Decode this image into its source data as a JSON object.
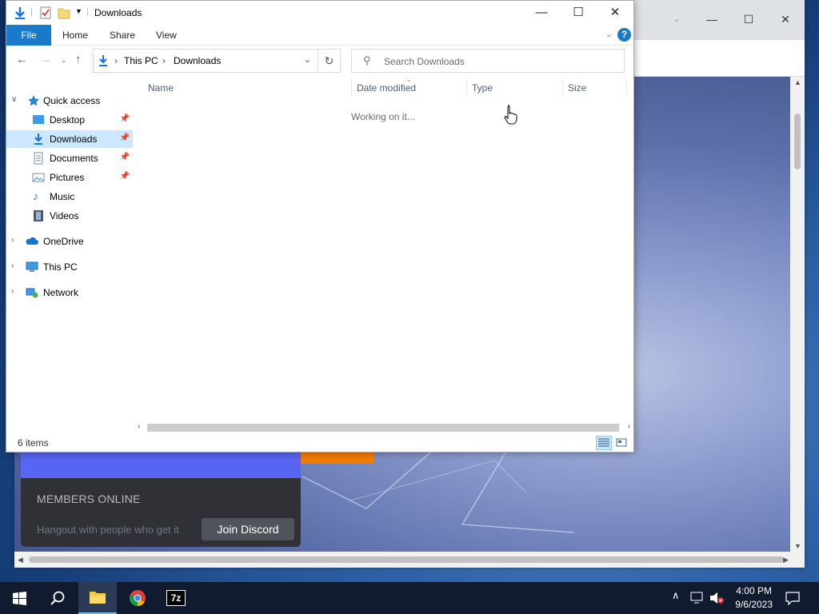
{
  "explorer": {
    "title": "Downloads",
    "ribbon_tabs": [
      "File",
      "Home",
      "Share",
      "View"
    ],
    "breadcrumb": [
      "This PC",
      "Downloads"
    ],
    "search_placeholder": "Search Downloads",
    "columns": [
      "Name",
      "Date modified",
      "Type",
      "Size"
    ],
    "status_message": "Working on it...",
    "item_count": "6 items",
    "nav": {
      "quick_access": "Quick access",
      "desktop": "Desktop",
      "downloads": "Downloads",
      "documents": "Documents",
      "pictures": "Pictures",
      "music": "Music",
      "videos": "Videos",
      "onedrive": "OneDrive",
      "this_pc": "This PC",
      "network": "Network"
    }
  },
  "discord": {
    "members_online": "MEMBERS ONLINE",
    "hangout": "Hangout with people who get it",
    "join_button": "Join Discord"
  },
  "taskbar": {
    "time": "4:00 PM",
    "date": "9/6/2023",
    "apps": [
      "start",
      "search",
      "file-explorer",
      "chrome",
      "7-zip"
    ],
    "seven_zip_label": "7z"
  },
  "colors": {
    "explorer_accent": "#1979ca",
    "selection": "#cce8ff",
    "discord_blurple": "#5865f2",
    "taskbar": "#101b30"
  }
}
